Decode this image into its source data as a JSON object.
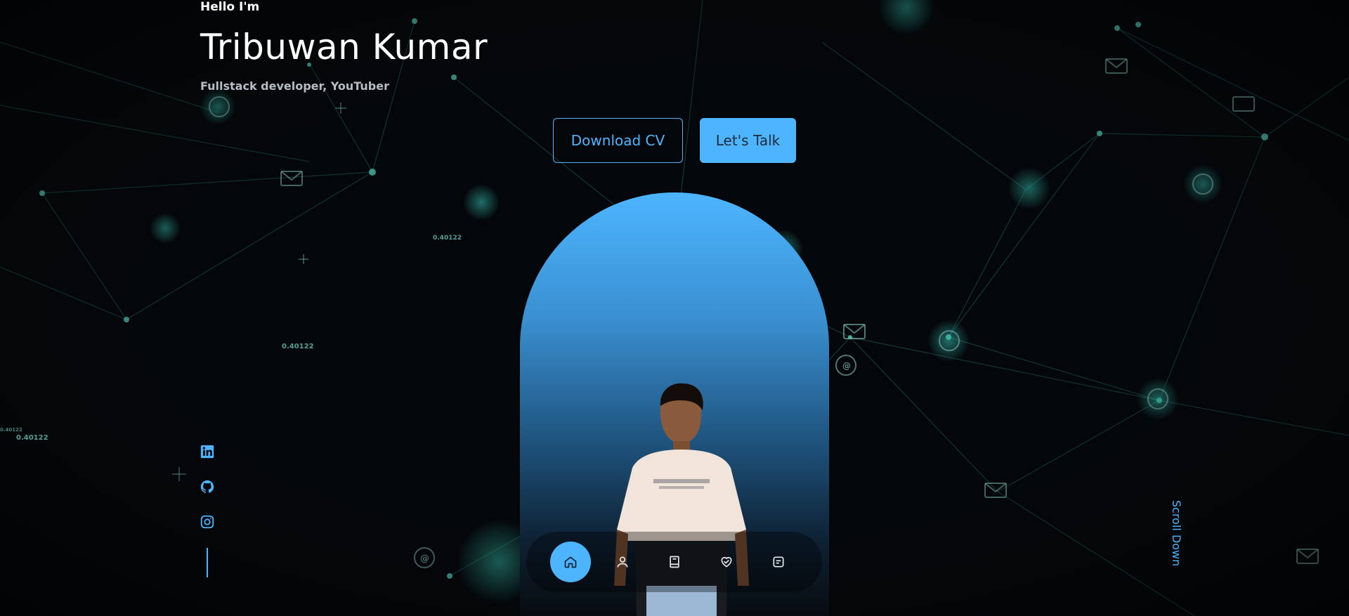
{
  "hero": {
    "greeting": "Hello I'm",
    "name": "Tribuwan Kumar",
    "role": "Fullstack developer, YouTuber"
  },
  "cta": {
    "download_label": "Download CV",
    "talk_label": "Let's Talk"
  },
  "background_labels": [
    "0.40122",
    "0.40122",
    "0.40122",
    "0.40122"
  ],
  "socials": [
    {
      "icon": "linkedin-icon"
    },
    {
      "icon": "github-icon"
    },
    {
      "icon": "instagram-icon"
    }
  ],
  "scroll_label": "Scroll Down",
  "nav": [
    {
      "icon": "home-icon",
      "active": true
    },
    {
      "icon": "user-icon",
      "active": false
    },
    {
      "icon": "book-icon",
      "active": false
    },
    {
      "icon": "services-icon",
      "active": false
    },
    {
      "icon": "message-icon",
      "active": false
    }
  ],
  "colors": {
    "accent": "#4db5ff",
    "background": "#040609",
    "network": "#2fb7a8"
  }
}
